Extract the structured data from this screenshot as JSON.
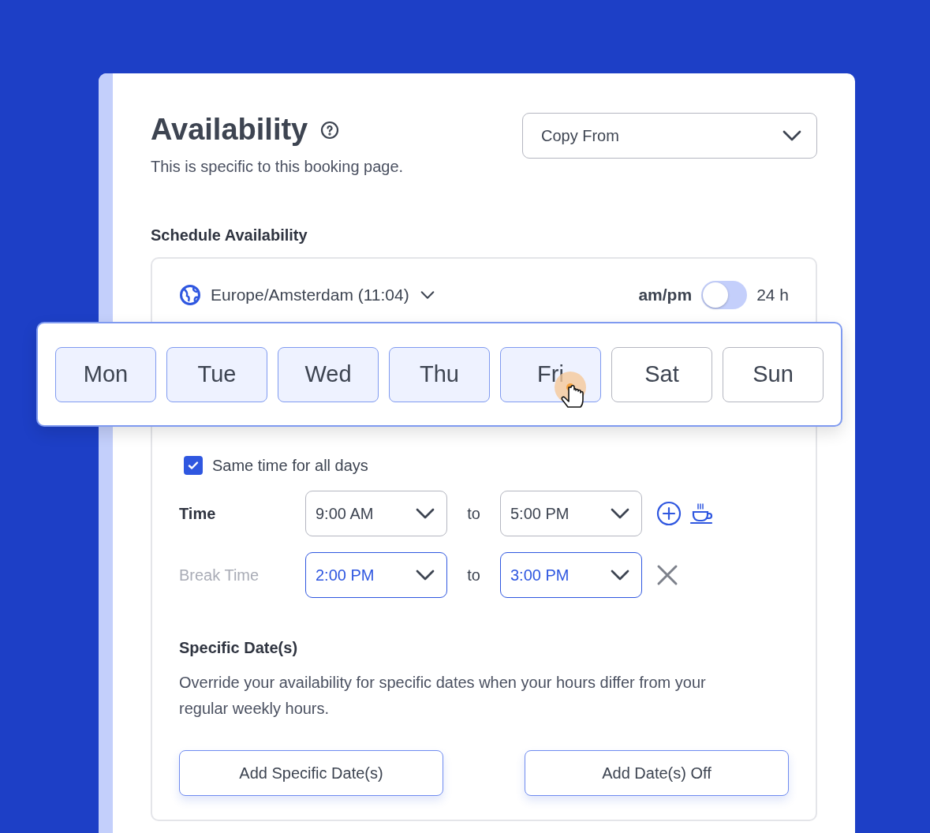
{
  "header": {
    "title": "Availability",
    "subtitle": "This is specific to this booking page.",
    "copy_from": {
      "placeholder": "Copy From"
    }
  },
  "schedule": {
    "title": "Schedule Availability",
    "timezone": "Europe/Amsterdam (11:04)",
    "format": {
      "left": "am/pm",
      "right": "24 h",
      "on": false
    },
    "days": [
      {
        "label": "Mon",
        "selected": true
      },
      {
        "label": "Tue",
        "selected": true
      },
      {
        "label": "Wed",
        "selected": true
      },
      {
        "label": "Thu",
        "selected": true
      },
      {
        "label": "Fri",
        "selected": true
      },
      {
        "label": "Sat",
        "selected": false
      },
      {
        "label": "Sun",
        "selected": false
      }
    ],
    "same_time": {
      "label": "Same time for all days",
      "checked": true
    },
    "rows": [
      {
        "kind": "work",
        "label": "Time",
        "from": "9:00 AM",
        "sep": "to",
        "to": "5:00 PM"
      },
      {
        "kind": "break",
        "label": "Break Time",
        "from": "2:00 PM",
        "sep": "to",
        "to": "3:00 PM"
      }
    ],
    "specific": {
      "title": "Specific Date(s)",
      "text": "Override your availability for specific dates when your hours differ from your regular weekly hours.",
      "buttons": [
        "Add Specific Date(s)",
        "Add Date(s) Off"
      ]
    }
  }
}
